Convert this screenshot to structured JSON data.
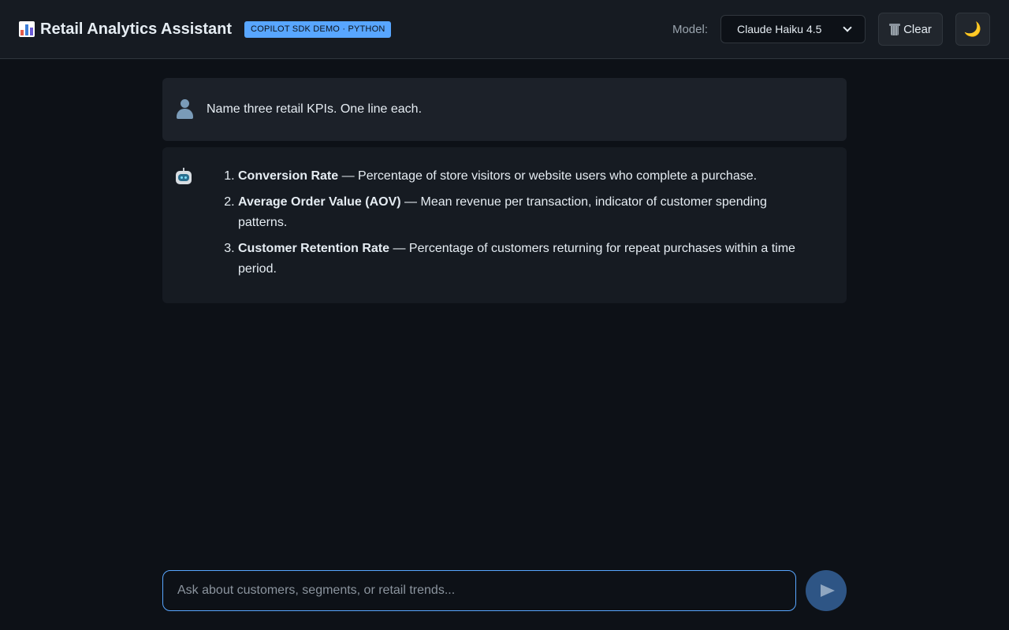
{
  "header": {
    "title": "Retail Analytics Assistant",
    "badge": "COPILOT SDK DEMO · PYTHON",
    "model_label": "Model:",
    "model_selected": "Claude Haiku 4.5",
    "clear_label": "Clear",
    "theme_icon": "🌙"
  },
  "conversation": {
    "user_message": "Name three retail KPIs. One line each.",
    "assistant_items": [
      {
        "name": "Conversion Rate",
        "rest": " — Percentage of store visitors or website users who complete a purchase."
      },
      {
        "name": "Average Order Value (AOV)",
        "rest": " — Mean revenue per transaction, indicator of customer spending patterns."
      },
      {
        "name": "Customer Retention Rate",
        "rest": " — Percentage of customers returning for repeat purchases within a time period."
      }
    ]
  },
  "composer": {
    "placeholder": "Ask about customers, segments, or retail trends..."
  },
  "colors": {
    "accent": "#58a6ff",
    "background": "#0d1117",
    "header": "#161b22"
  }
}
